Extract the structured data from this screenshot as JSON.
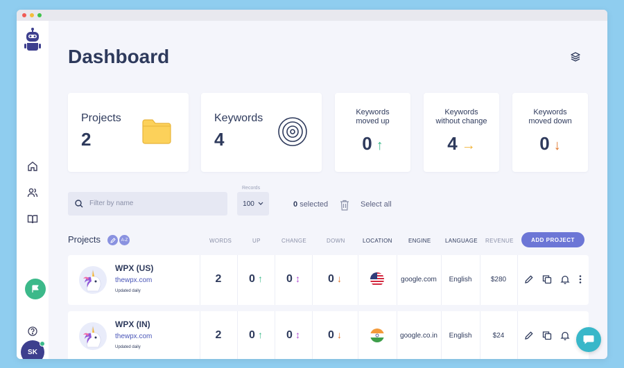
{
  "page": {
    "title": "Dashboard"
  },
  "user": {
    "initials": "SK"
  },
  "cards": {
    "projects": {
      "label": "Projects",
      "value": "2"
    },
    "keywords": {
      "label": "Keywords",
      "value": "4"
    },
    "moved_up": {
      "line1": "Keywords",
      "line2": "moved up",
      "value": "0",
      "arrow": "↑"
    },
    "no_change": {
      "line1": "Keywords",
      "line2": "without change",
      "value": "4",
      "arrow": "→"
    },
    "moved_down": {
      "line1": "Keywords",
      "line2": "moved down",
      "value": "0",
      "arrow": "↓"
    }
  },
  "filter": {
    "placeholder": "Filter by name",
    "records_label": "Records",
    "records_value": "100",
    "selected_count": "0",
    "selected_text": "selected",
    "select_all": "Select all"
  },
  "table": {
    "title": "Projects",
    "sort_badge": "A-Z",
    "columns": [
      "WORDS",
      "UP",
      "CHANGE",
      "DOWN",
      "LOCATION",
      "ENGINE",
      "LANGUAGE",
      "REVENUE"
    ],
    "add_button": "ADD PROJECT",
    "rows": [
      {
        "name": "WPX (US)",
        "url": "thewpx.com",
        "updated": "Updated daily",
        "words": "2",
        "up": "0",
        "change": "0",
        "down": "0",
        "location": "US",
        "engine": "google.com",
        "language": "English",
        "revenue": "$280"
      },
      {
        "name": "WPX (IN)",
        "url": "thewpx.com",
        "updated": "Updated daily",
        "words": "2",
        "up": "0",
        "change": "0",
        "down": "0",
        "location": "IN",
        "engine": "google.co.in",
        "language": "English",
        "revenue": "$24"
      }
    ]
  },
  "arrows": {
    "up": "↑",
    "change": "↕",
    "down": "↓"
  },
  "colors": {
    "accent": "#6c76d6",
    "up": "#3cb98a",
    "change": "#b04fd1",
    "down": "#e0742a",
    "neutral": "#f2b53a"
  }
}
